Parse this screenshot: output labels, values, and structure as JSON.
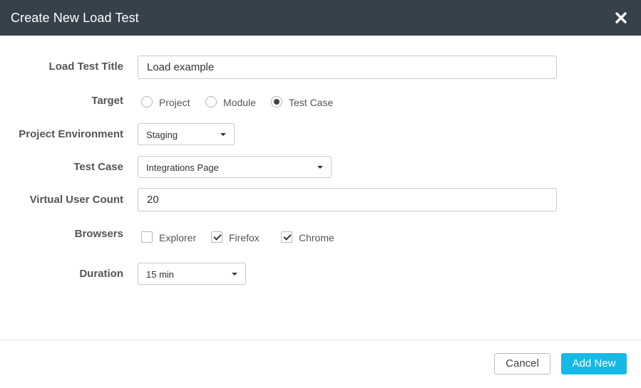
{
  "dialog": {
    "title": "Create New Load Test",
    "close_icon": "close-x-icon"
  },
  "form": {
    "title_field": {
      "label": "Load Test Title",
      "value": "Load example"
    },
    "target": {
      "label": "Target",
      "options": [
        "Project",
        "Module",
        "Test Case"
      ],
      "selected": "Test Case"
    },
    "environment": {
      "label": "Project Environment",
      "selected": "Staging"
    },
    "test_case": {
      "label": "Test Case",
      "selected": "Integrations Page"
    },
    "user_count": {
      "label": "Virtual User Count",
      "value": "20"
    },
    "browsers": {
      "label": "Browsers",
      "options": [
        {
          "name": "Explorer",
          "checked": false
        },
        {
          "name": "Firefox",
          "checked": true
        },
        {
          "name": "Chrome",
          "checked": true
        }
      ]
    },
    "duration": {
      "label": "Duration",
      "selected": "15 min"
    }
  },
  "footer": {
    "cancel_label": "Cancel",
    "add_label": "Add New"
  },
  "colors": {
    "header_bg": "#37414b",
    "primary_button": "#14b9e6"
  }
}
